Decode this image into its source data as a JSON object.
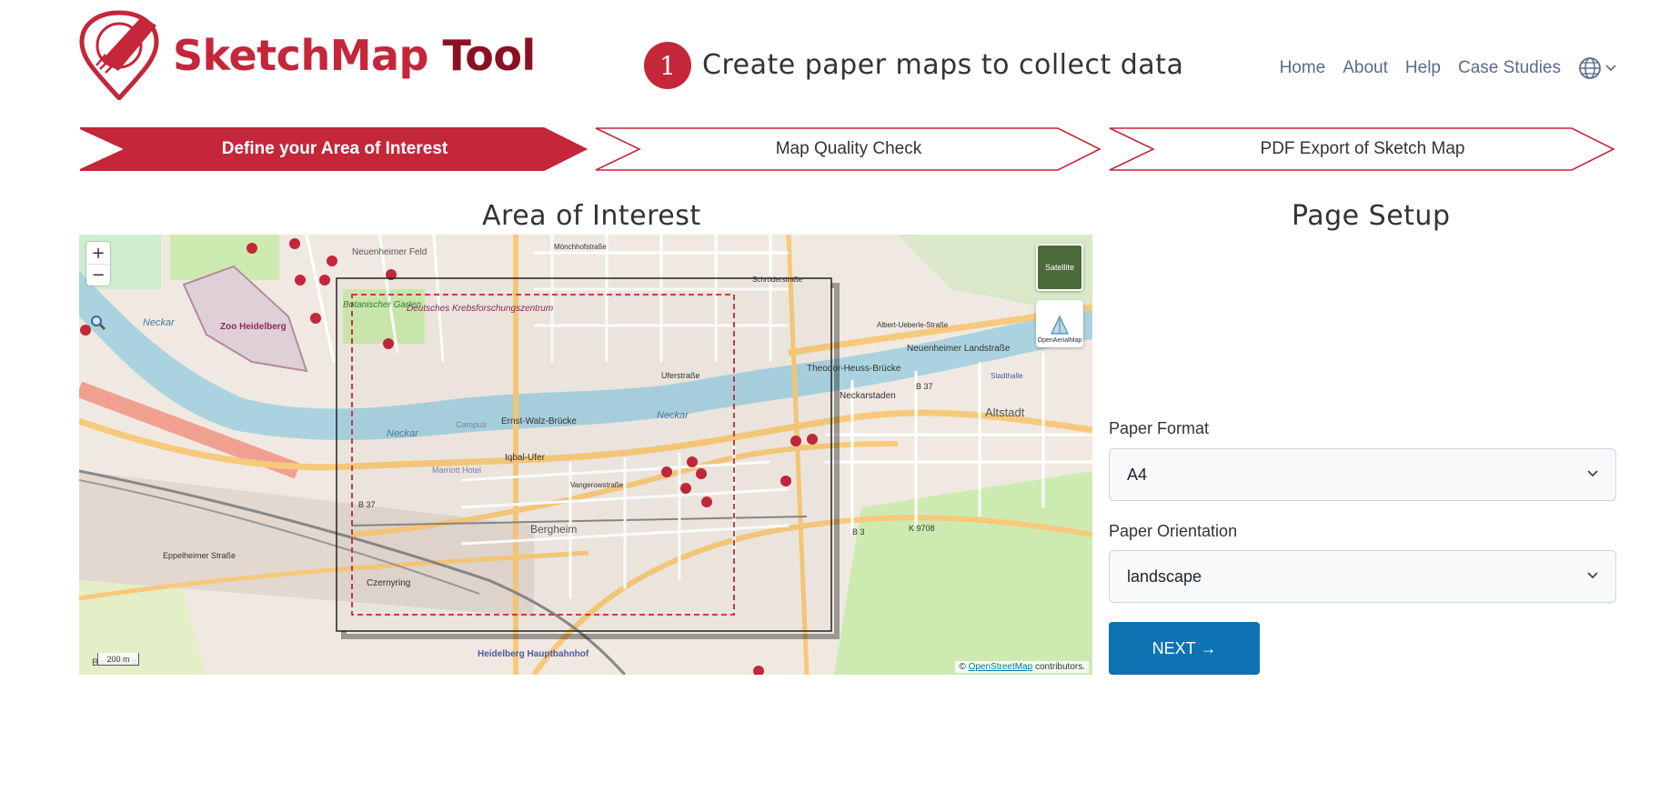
{
  "brand": {
    "part1": "SketchMap",
    "part2": "Tool"
  },
  "header": {
    "step_number": "1",
    "tagline": "Create paper maps to collect data"
  },
  "nav": {
    "items": [
      "Home",
      "About",
      "Help",
      "Case Studies"
    ],
    "language_icon": "globe-icon"
  },
  "steps": [
    {
      "label": "Define your Area of Interest",
      "active": true
    },
    {
      "label": "Map Quality Check",
      "active": false
    },
    {
      "label": "PDF Export of Sketch Map",
      "active": false
    }
  ],
  "area_of_interest": {
    "title": "Area of Interest",
    "zoom_in": "+",
    "zoom_out": "−",
    "layer_satellite": "Satellite",
    "layer_oam": "OpenAerialMap",
    "scale": "200 m",
    "attribution_link": "OpenStreetMap",
    "attribution_suffix": "contributors.",
    "labels": {
      "zoo": "Zoo Heidelberg",
      "neuenheimer_feld": "Neuenheimer Feld",
      "botanischer": "Botanischer Garten",
      "dkfz": "Deutsches Krebsforschungszentrum",
      "neckar1": "Neckar",
      "neckar2": "Neckar",
      "neckar3": "Neckar",
      "campus": "Campus",
      "marriott": "Marriott Hotel",
      "ernst_walz": "Ernst-Walz-Brücke",
      "iqbal": "Iqbal-Ufer",
      "bergheim": "Bergheim",
      "czernyring": "Czernyring",
      "hbf": "Heidelberg Hauptbahnhof",
      "bahnstadt": "Bahnstadt",
      "altstadt": "Altstadt",
      "theodor": "Theodor-Heuss-Brücke",
      "neckarstaden": "Neckarstaden",
      "neuenheimer_landstrasse": "Neuenheimer Landstraße",
      "uferstrasse": "Uferstraße",
      "b37a": "B 37",
      "b37b": "B 37",
      "b3": "B 3",
      "k9708": "K 9708",
      "eppelheimer": "Eppelheimer Straße",
      "vangerowstrasse": "Vangerowstraße",
      "stadthalle": "Stadthalle",
      "albert": "Albert-Ueberle-Straße",
      "schroderstrasse": "Schröderstraße",
      "moenchhofstrasse": "Mönchhofstraße"
    }
  },
  "page_setup": {
    "title": "Page Setup",
    "paper_format_label": "Paper Format",
    "paper_format_value": "A4",
    "paper_orientation_label": "Paper Orientation",
    "paper_orientation_value": "landscape",
    "next_button": "NEXT →"
  },
  "colors": {
    "brand_red": "#c4263a",
    "brand_dark_red": "#8b1023",
    "next_button": "#0d73b3",
    "river": "#aad3df"
  }
}
